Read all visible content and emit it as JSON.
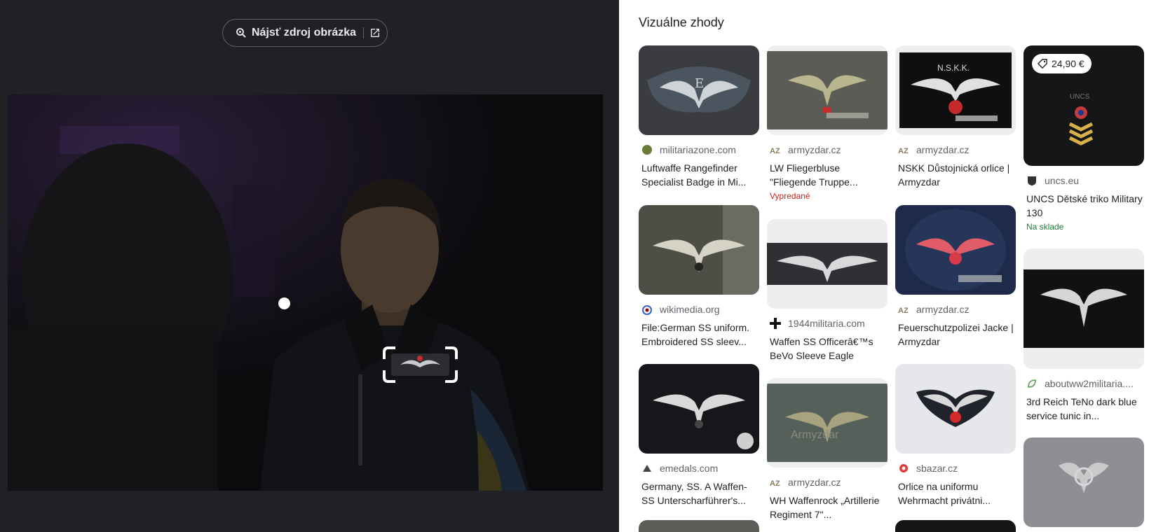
{
  "find_source": {
    "label": "Nájsť zdroj obrázka"
  },
  "panel": {
    "title": "Vizuálne zhody"
  },
  "results": [
    {
      "source": "militariazone.com",
      "title": "Luftwaffe Rangefinder Specialist Badge in Mi..."
    },
    {
      "source": "armyzdar.cz",
      "title": "LW Fliegerbluse \"Fliegende Truppe...",
      "status": "Vypredané"
    },
    {
      "source": "armyzdar.cz",
      "title": "NSKK Důstojnická orlice | Armyzdar"
    },
    {
      "source": "uncs.eu",
      "title": "UNCS Dětské triko Military 130",
      "status": "Na sklade",
      "price": "24,90 €"
    },
    {
      "source": "wikimedia.org",
      "title": "File:German SS uniform. Embroidered SS sleev..."
    },
    {
      "source": "1944militaria.com",
      "title": "Waffen SS Officerâ€™s BeVo Sleeve Eagle"
    },
    {
      "source": "armyzdar.cz",
      "title": "Feuerschutzpolizei Jacke | Armyzdar"
    },
    {
      "source": "aboutww2militaria....",
      "title": "3rd Reich TeNo dark blue service tunic in..."
    },
    {
      "source": "emedals.com",
      "title": "Germany, SS. A Waffen-SS Unterscharführer's..."
    },
    {
      "source": "armyzdar.cz",
      "title": "WH Waffenrock „Artillerie Regiment 7\"..."
    },
    {
      "source": "sbazar.cz",
      "title": "Orlice na uniformu Wehrmacht privátni..."
    }
  ],
  "colors": {
    "panel_bg": "#ffffff",
    "viewer_bg": "#202124",
    "sold_out": "#c5221f",
    "in_stock": "#188038"
  }
}
